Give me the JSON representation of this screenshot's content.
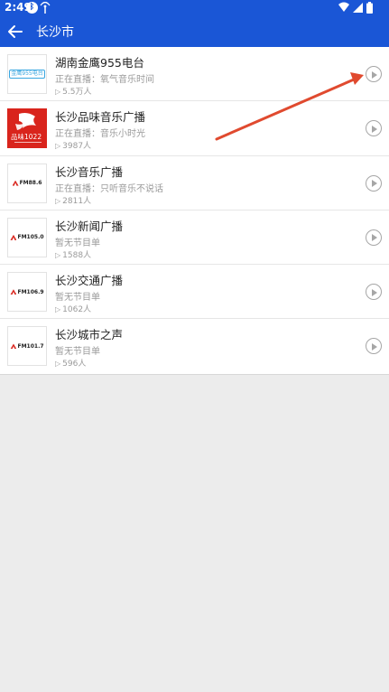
{
  "status_bar": {
    "time": "2:49"
  },
  "app_bar": {
    "title": "长沙市"
  },
  "stations": [
    {
      "name": "湖南金鹰955电台",
      "subtitle": "正在直播：氧气音乐时间",
      "listeners": "5.5万人",
      "logo_text": "金鹰955电台"
    },
    {
      "name": "长沙品味音乐广播",
      "subtitle": "正在直播：音乐小时光",
      "listeners": "3987人",
      "logo_text": "品味1022"
    },
    {
      "name": "长沙音乐广播",
      "subtitle": "正在直播：只听音乐不说话",
      "listeners": "2811人",
      "logo_text": "FM88.6"
    },
    {
      "name": "长沙新闻广播",
      "subtitle": "暂无节目单",
      "listeners": "1588人",
      "logo_text": "FM105.0"
    },
    {
      "name": "长沙交通广播",
      "subtitle": "暂无节目单",
      "listeners": "1062人",
      "logo_text": "FM106.9"
    },
    {
      "name": "长沙城市之声",
      "subtitle": "暂无节目单",
      "listeners": "596人",
      "logo_text": "FM101.7"
    }
  ],
  "colors": {
    "accent": "#1a56d6",
    "annotation": "#e04a2f",
    "logo_red": "#d9241c"
  }
}
